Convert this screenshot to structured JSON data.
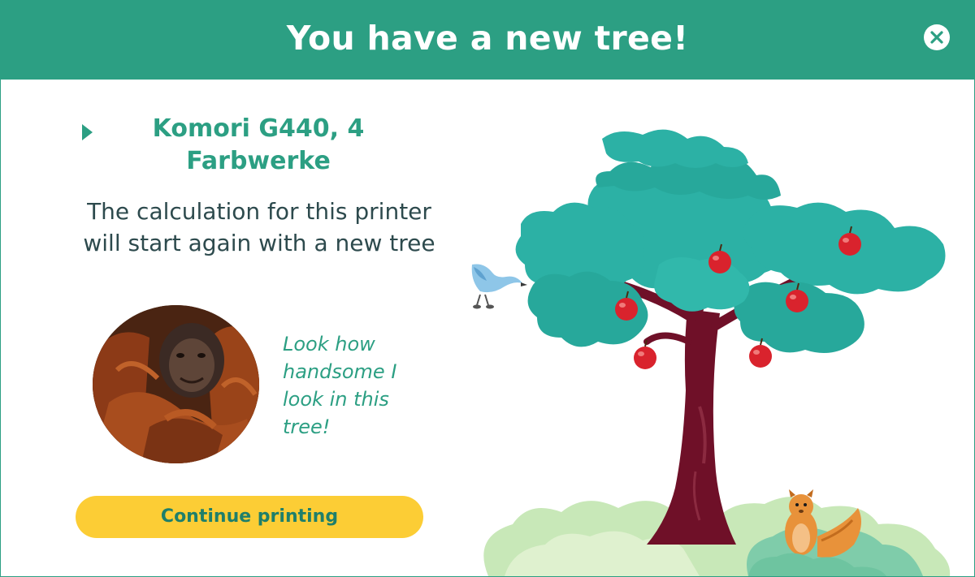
{
  "dialog": {
    "title": "You have a new tree!"
  },
  "printer": {
    "name": "Komori G440, 4 Farbwerke"
  },
  "message": {
    "text": "The calculation for this printer will start again with a new tree"
  },
  "mascot": {
    "quote": "Look how handsome I look in this tree!"
  },
  "actions": {
    "continue_label": "Continue printing"
  },
  "icons": {
    "close": "close-icon",
    "expand": "caret-right-icon"
  },
  "colors": {
    "brand": "#2c9f83",
    "button": "#fccd35",
    "foliage": "#2cb1a5",
    "trunk": "#6f1028",
    "apple": "#d9232d",
    "bush_light": "#c8e8b8",
    "bush_mid": "#7fccaa"
  }
}
